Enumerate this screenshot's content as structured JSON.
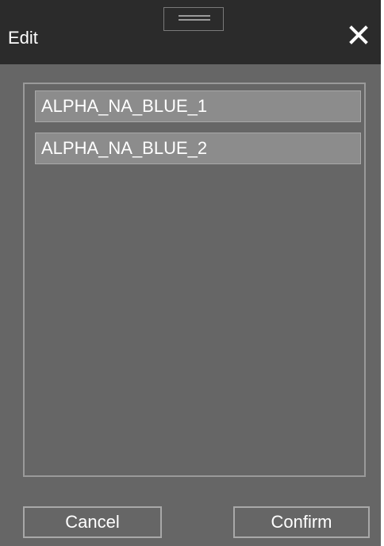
{
  "dialog": {
    "title": "Edit",
    "close_icon": "close-icon",
    "drag_icon": "drag-handle-icon"
  },
  "list": {
    "items": [
      {
        "label": "ALPHA_NA_BLUE_1"
      },
      {
        "label": "ALPHA_NA_BLUE_2"
      }
    ]
  },
  "footer": {
    "cancel_label": "Cancel",
    "confirm_label": "Confirm"
  },
  "colors": {
    "titlebar_bg": "#2b2b2b",
    "dialog_bg": "#666666",
    "item_bg": "#8c8c8c",
    "text": "#ffffff"
  }
}
